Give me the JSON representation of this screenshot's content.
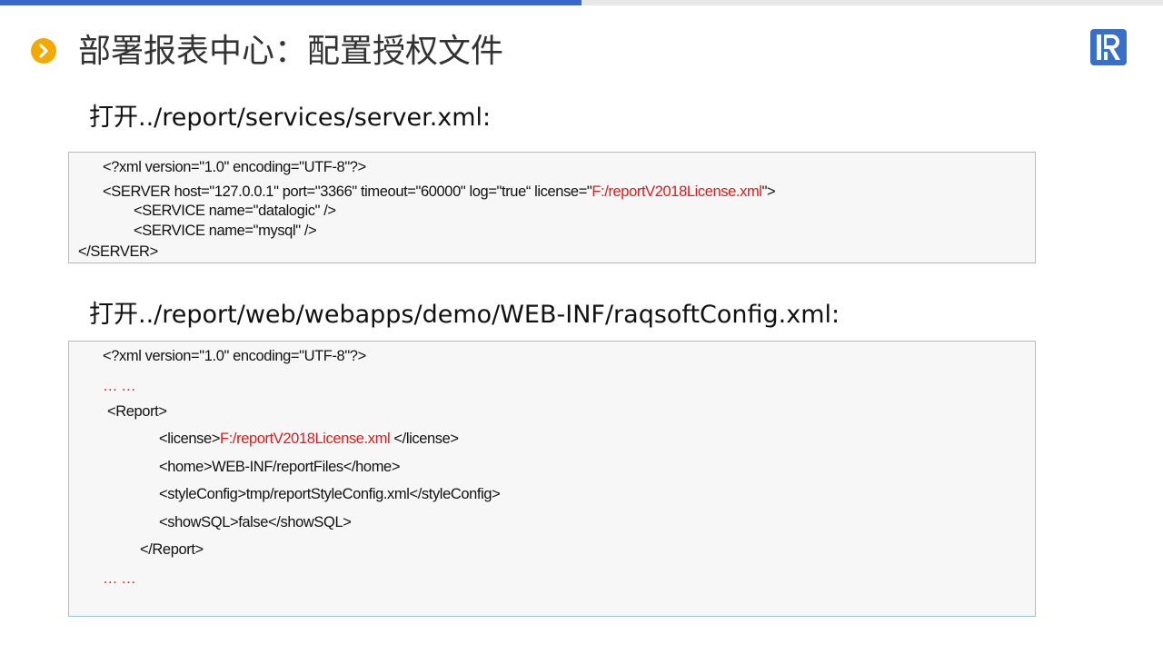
{
  "header": {
    "title": "部署报表中心：配置授权文件",
    "logo_icon": "raqsoft-R-logo",
    "accent_color": "#3a68c6",
    "bullet_color": "#f2a900"
  },
  "section1": {
    "heading": "打开../report/services/server.xml:",
    "xml_decl": "<?xml version=\"1.0\" encoding=\"UTF-8\"?>",
    "server_open_a": "<SERVER host=\"127.0.0.1\" port=\"3366\" timeout=\"60000\" log=\"true“ license=\"",
    "server_license": "F:/reportV2018License.xml",
    "server_open_b": "\">",
    "service1": "<SERVICE name=\"datalogic\" />",
    "service2": "<SERVICE name=\"mysql\" />",
    "server_close": "</SERVER>"
  },
  "section2": {
    "heading": "打开../report/web/webapps/demo/WEB-INF/raqsoftConfig.xml:",
    "xml_decl": "<?xml version=\"1.0\" encoding=\"UTF-8\"?>",
    "ellipsis_top": "… …",
    "report_open": "<Report>",
    "license_open": "<license>",
    "license_value": "F:/reportV2018License.xml",
    "license_close": " </license>",
    "home": "<home>WEB-INF/reportFiles</home>",
    "style_config": "<styleConfig>tmp/reportStyleConfig.xml</styleConfig>",
    "show_sql": "<showSQL>false</showSQL>",
    "report_close": "</Report>",
    "ellipsis_bottom": "… …"
  }
}
